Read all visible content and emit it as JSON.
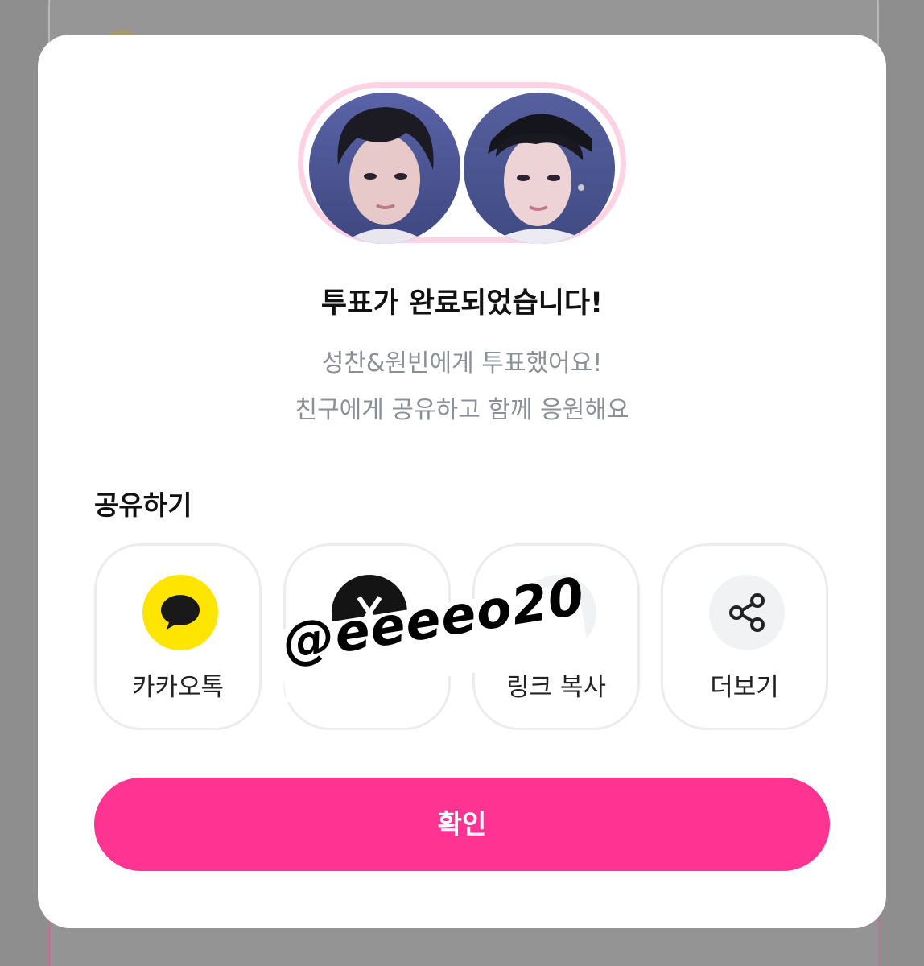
{
  "modal": {
    "title": "투표가 완료되었습니다!",
    "subtitle_line1": "성찬&원빈에게 투표했어요!",
    "subtitle_line2": "친구에게 공유하고 함께 응원해요",
    "avatars": [
      "member-1-photo",
      "member-2-photo"
    ]
  },
  "share": {
    "heading": "공유하기",
    "buttons": [
      {
        "label": "카카오톡",
        "icon": "kakaotalk-icon",
        "color": "#fee500"
      },
      {
        "label": "",
        "icon": "x-icon",
        "color": "#141414"
      },
      {
        "label": "링크 복사",
        "icon": "link-icon",
        "color": "#f1f2f4"
      },
      {
        "label": "더보기",
        "icon": "share-icon",
        "color": "#f1f2f4"
      }
    ]
  },
  "watermark": "@eeeeo20",
  "confirm_label": "확인",
  "colors": {
    "accent": "#ff3392",
    "avatar_border": "#fdd3e3",
    "kakao": "#fee500"
  }
}
